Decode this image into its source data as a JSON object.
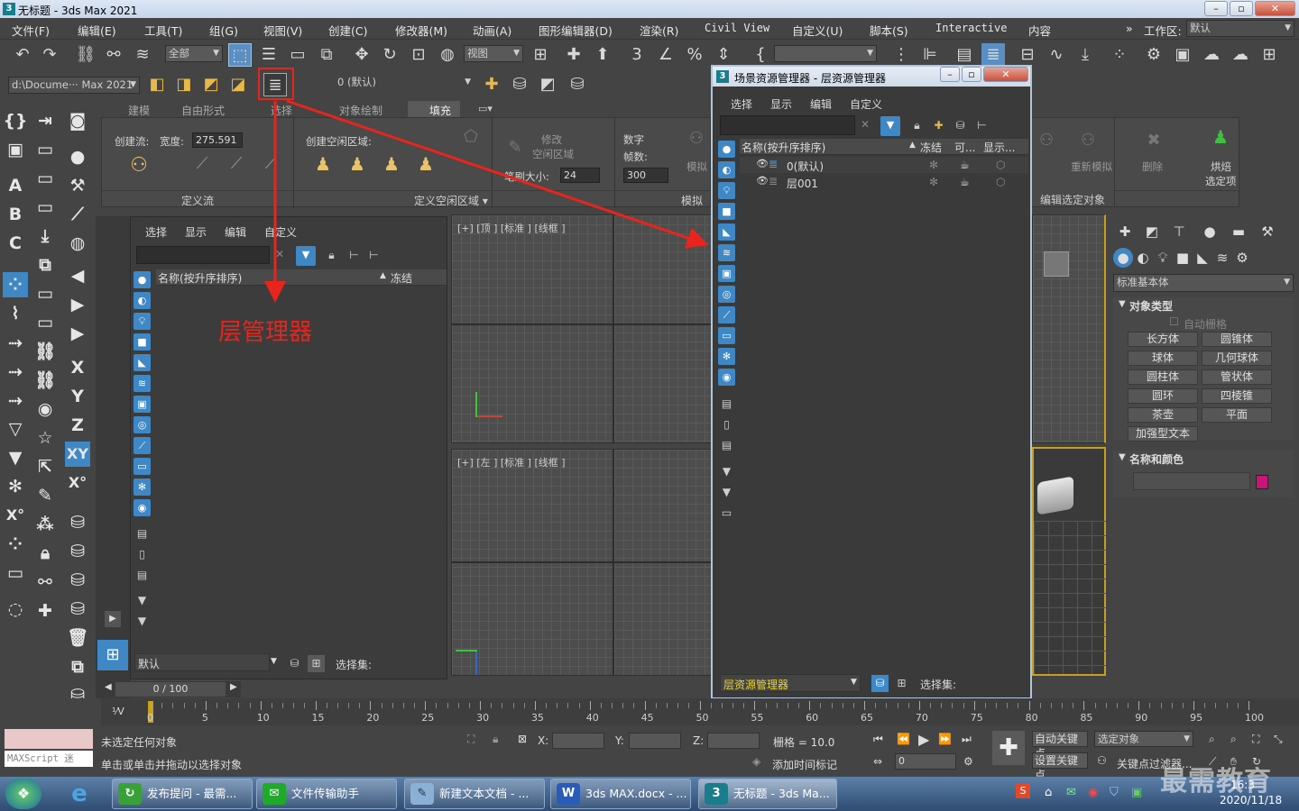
{
  "window": {
    "title": "无标题 - 3ds Max 2021",
    "app_icon": "3"
  },
  "menu": [
    "文件(F)",
    "编辑(E)",
    "工具(T)",
    "组(G)",
    "视图(V)",
    "创建(C)",
    "修改器(M)",
    "动画(A)",
    "图形编辑器(D)",
    "渲染(R)",
    "Civil View",
    "自定义(U)",
    "脚本(S)",
    "Interactive",
    "内容"
  ],
  "workspace": {
    "label": "工作区:",
    "value": "默认"
  },
  "toolbar": {
    "filter_dropdown": "全部",
    "refcoord_dropdown": "视图",
    "path_dropdown": "d:\\Docume··· Max 2021",
    "layer_dropdown": "0 (默认)"
  },
  "ribbon": {
    "tabs": [
      "建模",
      "自由形式",
      "选择",
      "对象绘制",
      "填充"
    ],
    "active_tab": "填充",
    "create_flow_label": "创建流:",
    "width_label": "宽度:",
    "width_value": "275.591",
    "create_idle_label": "创建空闲区域:",
    "modify_label": "修改",
    "idle_area_label": "空闲区域",
    "brush_size_label": "笔刷大小:",
    "brush_size_value": "24",
    "number_label": "数字",
    "frames_label": "帧数:",
    "frames_value": "300",
    "simulate_partial": "模拟",
    "define_flow_group": "定义流",
    "define_idle_group": "定义空闲区域 ▾",
    "simulate_group": "模拟",
    "resimulate": "重新模拟",
    "delete": "删除",
    "bake_selected_1": "烘焙",
    "bake_selected_2": "选定项",
    "edit_selected_group": "编辑选定对象"
  },
  "scene_explorer_left": {
    "menus": [
      "选择",
      "显示",
      "编辑",
      "自定义"
    ],
    "col_name": "名称(按升序排序)",
    "col_freeze": "冻结",
    "bottom_dropdown": "默认",
    "selection_set_label": "选择集:"
  },
  "annotation": {
    "label": "层管理器",
    "color": "#e8241c"
  },
  "layer_manager_window": {
    "title": "场景资源管理器 - 层资源管理器",
    "menus": [
      "选择",
      "显示",
      "编辑",
      "自定义"
    ],
    "columns": [
      "名称(按升序排序)",
      "冻结",
      "可...",
      "显示..."
    ],
    "rows": [
      {
        "name": "0(默认)"
      },
      {
        "name": "层001"
      }
    ],
    "bottom_dropdown": "层资源管理器",
    "selection_set_label": "选择集:"
  },
  "viewports": {
    "top": "[+] [顶 ] [标准 ] [线框 ]",
    "left": "[+] [左 ] [标准 ] [线框 ]"
  },
  "command_panel": {
    "category_dropdown": "标准基本体",
    "object_type_header": "对象类型",
    "autogrid": "自动栅格",
    "objects": [
      "长方体",
      "圆锥体",
      "球体",
      "几何球体",
      "圆柱体",
      "管状体",
      "圆环",
      "四棱锥",
      "茶壶",
      "平面",
      "加强型文本"
    ],
    "name_color_header": "名称和颜色",
    "object_color": "#c8157a"
  },
  "timeline": {
    "frame_counter": "0 / 100",
    "ticks": [
      "0",
      "5",
      "10",
      "15",
      "20",
      "25",
      "30",
      "35",
      "40",
      "45",
      "50",
      "55",
      "60",
      "65",
      "70",
      "75",
      "80",
      "85",
      "90",
      "95",
      "100"
    ]
  },
  "status": {
    "maxscript": "MAXScript 迷",
    "line1": "未选定任何对象",
    "line2": "单击或单击并拖动以选择对象",
    "x_label": "X:",
    "y_label": "Y:",
    "z_label": "Z:",
    "grid": "栅格 = 10.0",
    "add_time_tag": "添加时间标记",
    "auto_key": "自动关键点",
    "selected_object": "选定对象",
    "set_key": "设置关键点",
    "key_filter": "关键点过滤器...",
    "frame_value": "0"
  },
  "taskbar": {
    "items": [
      "发布提问 - 最需...",
      "文件传输助手",
      "新建文本文档 - ...",
      "3ds MAX.docx - ...",
      "无标题 - 3ds Ma..."
    ],
    "time": "16:3",
    "date": "2020/11/18",
    "watermark": "最需教育"
  }
}
